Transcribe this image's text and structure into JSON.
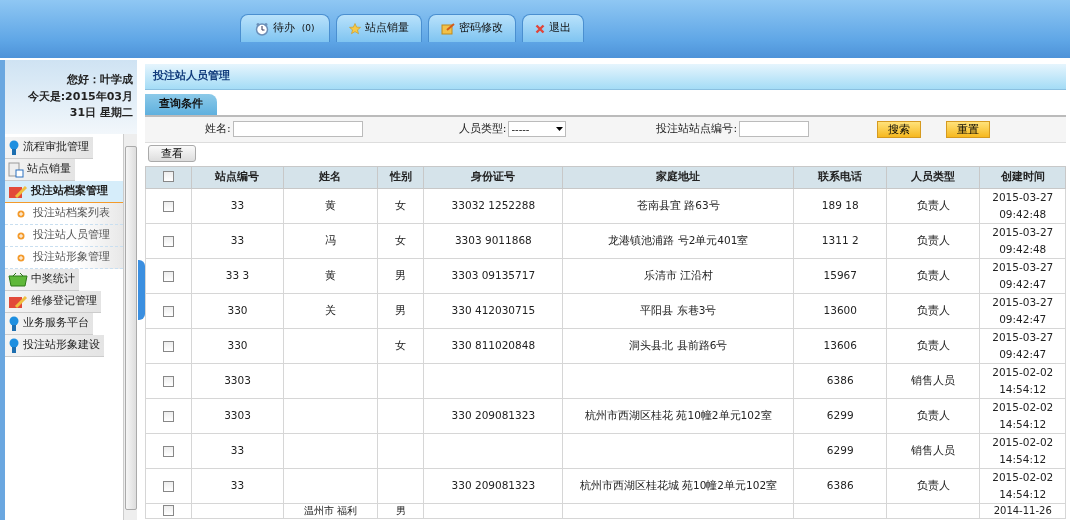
{
  "top_nav": [
    {
      "label": "待办",
      "count": "(0)"
    },
    {
      "label": "站点销量"
    },
    {
      "label": "密码修改"
    },
    {
      "label": "退出"
    }
  ],
  "sidebar": {
    "greeting": "您好：叶学成",
    "date": "今天是:2015年03月31日 星期二",
    "menu": [
      {
        "label": "流程审批管理",
        "selected": false
      },
      {
        "label": "站点销量",
        "selected": false
      },
      {
        "label": "投注站档案管理",
        "selected": true,
        "expanded": true,
        "children": [
          {
            "label": "投注站档案列表",
            "selected": false
          },
          {
            "label": "投注站人员管理",
            "selected": false
          },
          {
            "label": "投注站形象管理",
            "selected": false
          }
        ]
      },
      {
        "label": "中奖统计",
        "selected": false
      },
      {
        "label": "维修登记管理",
        "selected": false
      },
      {
        "label": "业务服务平台",
        "selected": false
      },
      {
        "label": "投注站形象建设",
        "selected": false
      }
    ]
  },
  "page_title": "投注站人员管理",
  "query": {
    "title": "查询条件",
    "name_label": "姓名:",
    "type_label": "人员类型:",
    "type_value": "-----",
    "station_label": "投注站站点编号:",
    "buttons": [
      "搜索",
      "重置"
    ]
  },
  "view_button": "查看",
  "table": {
    "columns": [
      "站点编号",
      "姓名",
      "性别",
      "身份证号",
      "家庭地址",
      "联系电话",
      "人员类型",
      "创建时间"
    ],
    "header_checked": false,
    "rows": [
      {
        "checked": false,
        "cells": [
          "33",
          "黄",
          "女",
          "33032 1252288",
          "苍南县宜 路63号",
          "189 18",
          "负责人",
          "2015-03-27 09:42:48"
        ]
      },
      {
        "checked": false,
        "cells": [
          "33",
          "冯",
          "女",
          "3303 9011868",
          "龙港镇池浦路 号2单元401室",
          "1311 2",
          "负责人",
          "2015-03-27 09:42:48"
        ]
      },
      {
        "checked": false,
        "cells": [
          "33 3",
          "黄",
          "男",
          "3303 09135717",
          "乐清市 江沿村",
          "15967",
          "负责人",
          "2015-03-27 09:42:47"
        ]
      },
      {
        "checked": false,
        "cells": [
          "330",
          "关",
          "男",
          "330 412030715",
          "平阳县 东巷3号",
          "13600",
          "负责人",
          "2015-03-27 09:42:47"
        ]
      },
      {
        "checked": false,
        "cells": [
          "330",
          "",
          "女",
          "330 811020848",
          "洞头县北 县前路6号",
          "13606",
          "负责人",
          "2015-03-27 09:42:47"
        ]
      },
      {
        "checked": false,
        "cells": [
          "3303",
          "",
          "",
          "",
          "",
          "6386",
          "销售人员",
          "2015-02-02 14:54:12"
        ]
      },
      {
        "checked": false,
        "cells": [
          "3303",
          "",
          "",
          "330 209081323",
          "杭州市西湖区桂花 苑10幢2单元102室",
          "6299",
          "负责人",
          "2015-02-02 14:54:12"
        ]
      },
      {
        "checked": false,
        "cells": [
          "33",
          "",
          "",
          "",
          "",
          "6299",
          "销售人员",
          "2015-02-02 14:54:12"
        ]
      },
      {
        "checked": false,
        "cells": [
          "33",
          "",
          "",
          "330 209081323",
          "杭州市西湖区桂花城 苑10幢2单元102室",
          "6386",
          "负责人",
          "2015-02-02 14:54:12"
        ]
      },
      {
        "checked": false,
        "cells": [
          "",
          "温州市 福利",
          "男",
          "",
          "",
          "",
          "",
          "2014-11-26"
        ]
      }
    ]
  }
}
